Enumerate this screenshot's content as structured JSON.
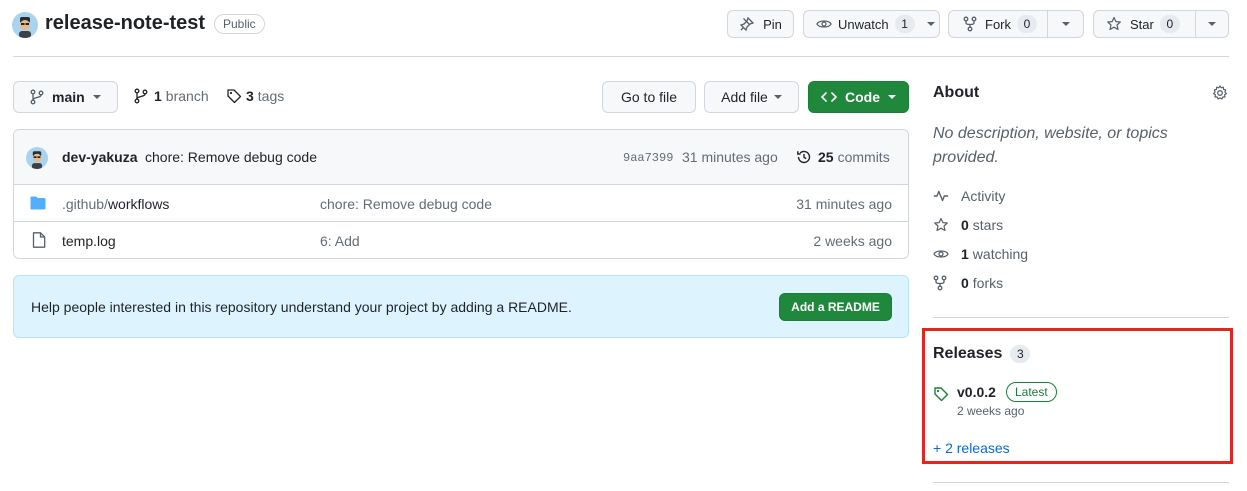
{
  "repo": {
    "name": "release-note-test",
    "visibility": "Public"
  },
  "header_actions": {
    "pin_label": "Pin",
    "watch_label": "Unwatch",
    "watch_count": "1",
    "fork_label": "Fork",
    "fork_count": "0",
    "star_label": "Star",
    "star_count": "0"
  },
  "toolbar": {
    "branch_name": "main",
    "branch_count": "1",
    "branch_word": "branch",
    "tag_count": "3",
    "tag_word": "tags",
    "go_to_file": "Go to file",
    "add_file": "Add file",
    "code": "Code"
  },
  "latest_commit": {
    "author": "dev-yakuza",
    "message": "chore: Remove debug code",
    "sha": "9aa7399",
    "time": "31 minutes ago",
    "commit_count": "25",
    "commit_word": "commits"
  },
  "files": [
    {
      "icon": "folder-icon",
      "prefix": ".github/",
      "name": "workflows",
      "message": "chore: Remove debug code",
      "time": "31 minutes ago"
    },
    {
      "icon": "file-icon",
      "prefix": "",
      "name": "temp.log",
      "message": "6: Add",
      "time": "2 weeks ago"
    }
  ],
  "readme_banner": {
    "text": "Help people interested in this repository understand your project by adding a README.",
    "button": "Add a README"
  },
  "about": {
    "heading": "About",
    "description": "No description, website, or topics provided.",
    "activity": "Activity",
    "stars_count": "0",
    "stars_word": "stars",
    "watching_count": "1",
    "watching_word": "watching",
    "forks_count": "0",
    "forks_word": "forks"
  },
  "releases": {
    "heading": "Releases",
    "count": "3",
    "latest_tag": "v0.0.2",
    "latest_badge": "Latest",
    "latest_time": "2 weeks ago",
    "more_link": "+ 2 releases"
  },
  "colors": {
    "green": "#1f883d",
    "link": "#0969da",
    "highlight": "#e5261d",
    "banner_bg": "#ddf4ff"
  }
}
